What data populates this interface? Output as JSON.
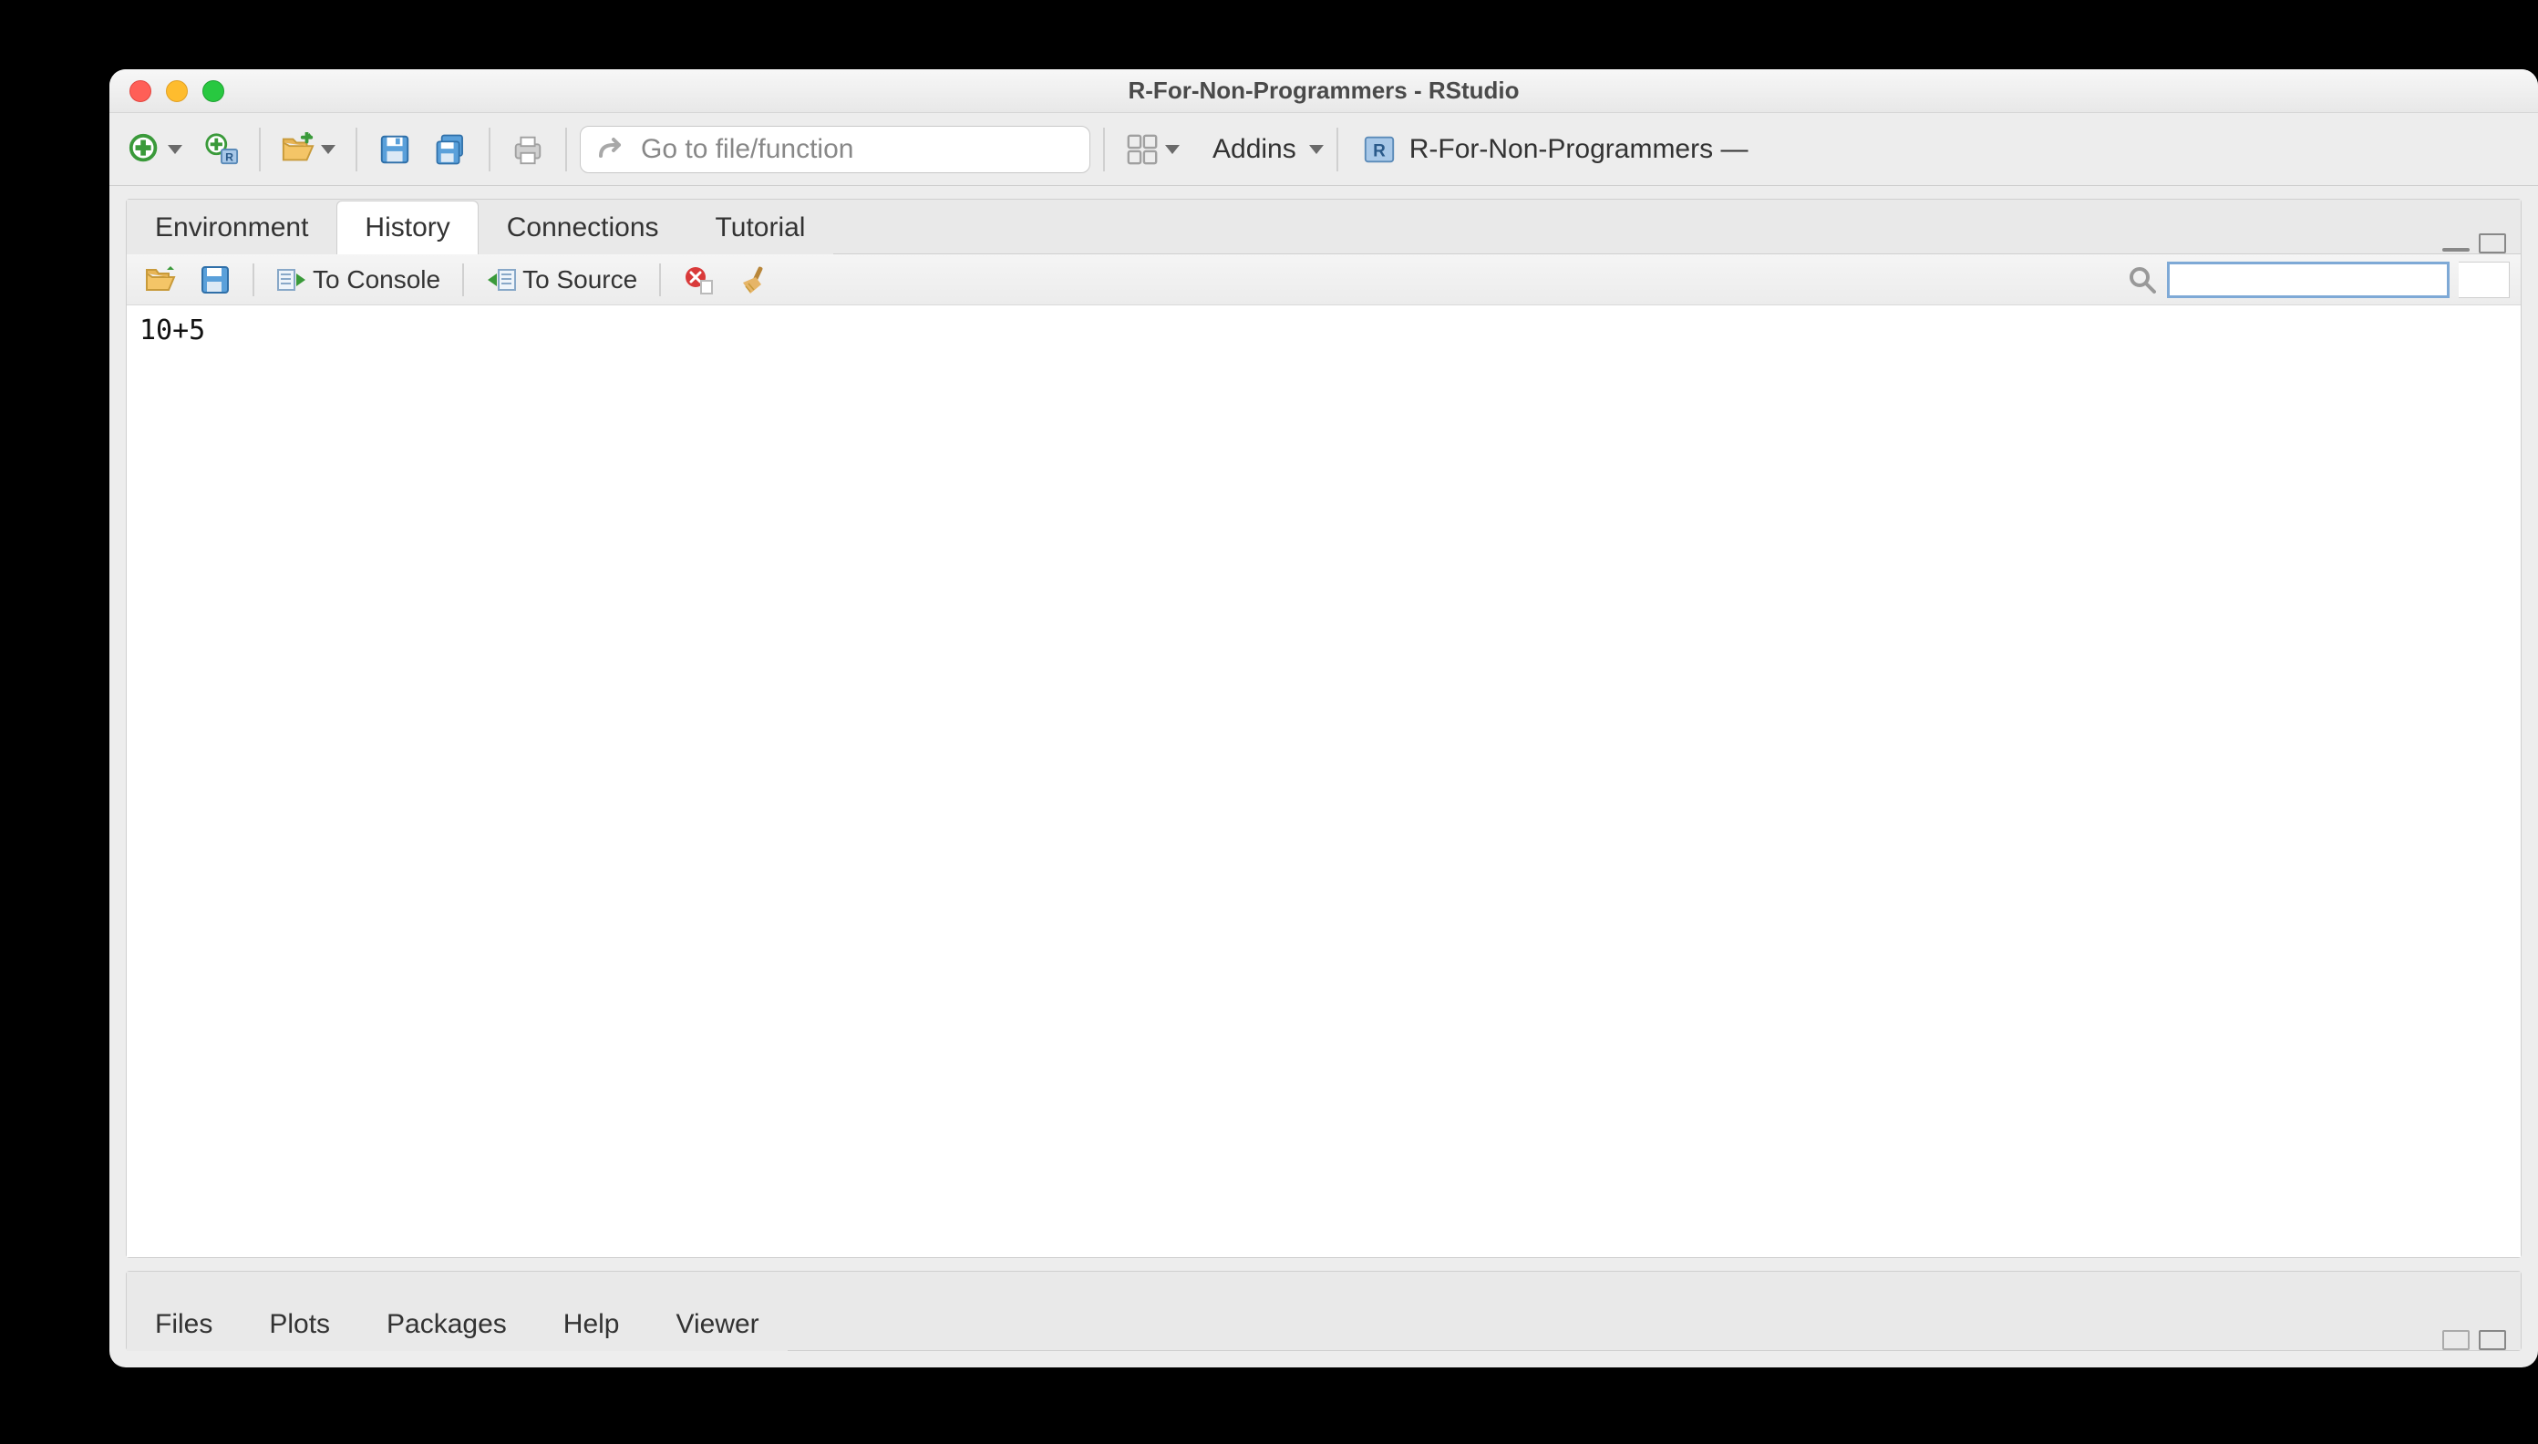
{
  "window": {
    "title": "R-For-Non-Programmers - RStudio"
  },
  "toolbar": {
    "goto_placeholder": "Go to file/function",
    "addins_label": "Addins",
    "project_label": "R-For-Non-Programmers — "
  },
  "top_pane": {
    "tabs": [
      "Environment",
      "History",
      "Connections",
      "Tutorial"
    ],
    "active_tab_index": 1,
    "toolbar": {
      "to_console_label": "To Console",
      "to_source_label": "To Source"
    },
    "history_entries": [
      "10+5"
    ]
  },
  "bottom_pane": {
    "tabs": [
      "Files",
      "Plots",
      "Packages",
      "Help",
      "Viewer"
    ]
  }
}
